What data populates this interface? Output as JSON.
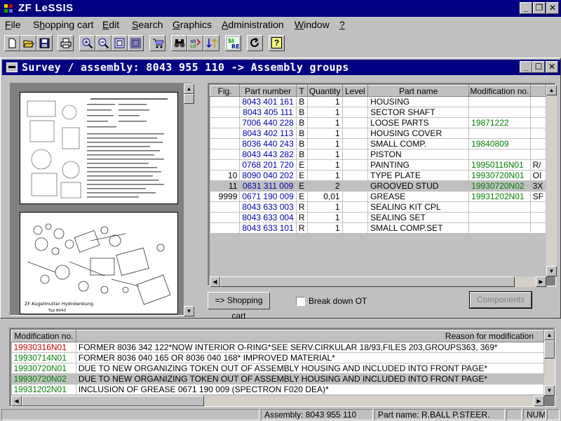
{
  "app": {
    "title": "ZF LeSSIS"
  },
  "menu": [
    {
      "label": "File",
      "u": "F",
      "rest": "ile"
    },
    {
      "label": "Shopping cart",
      "pre": "S",
      "u": "h",
      "rest": "opping cart"
    },
    {
      "label": "Edit",
      "u": "E",
      "rest": "dit"
    },
    {
      "label": "Search",
      "u": "S",
      "rest": "earch"
    },
    {
      "label": "Graphics",
      "u": "G",
      "rest": "raphics"
    },
    {
      "label": "Administration",
      "u": "A",
      "rest": "dministration"
    },
    {
      "label": "Window",
      "u": "W",
      "rest": "indow"
    },
    {
      "label": "?",
      "u": "?",
      "rest": ""
    }
  ],
  "toolbar": {
    "buttons": [
      "new-icon",
      "open-icon",
      "save-icon",
      "print-icon",
      "zoom-in-icon",
      "zoom-out-icon",
      "zoom-fit-icon",
      "zoom-page-icon",
      "shopping-cart-icon",
      "binoculars-icon",
      "search-abc-icon",
      "sort-arrows-icon",
      "si-re-icon",
      "refresh-icon",
      "help-icon"
    ],
    "si_label": "SI",
    "re_label": "RE",
    "help_label": "?"
  },
  "child_window": {
    "title": "Survey / assembly: 8043 955 110 -> Assembly groups"
  },
  "parts_table": {
    "columns": [
      "Fig.",
      "Part number",
      "T",
      "Quantity",
      "Level",
      "Part name",
      "Modification no.",
      ""
    ],
    "rows": [
      {
        "fig": "",
        "part_number": "8043 401 161",
        "t": "B",
        "quantity": "1",
        "level": "",
        "part_name": "HOUSING",
        "mod": "",
        "extra": ""
      },
      {
        "fig": "",
        "part_number": "8043 405 111",
        "t": "B",
        "quantity": "1",
        "level": "",
        "part_name": "SECTOR SHAFT",
        "mod": "",
        "extra": ""
      },
      {
        "fig": "",
        "part_number": "7006 440 228",
        "t": "B",
        "quantity": "1",
        "level": "",
        "part_name": "LOOSE PARTS",
        "mod": "19871222",
        "extra": ""
      },
      {
        "fig": "",
        "part_number": "8043 402 113",
        "t": "B",
        "quantity": "1",
        "level": "",
        "part_name": "HOUSING COVER",
        "mod": "",
        "extra": ""
      },
      {
        "fig": "",
        "part_number": "8036 440 243",
        "t": "B",
        "quantity": "1",
        "level": "",
        "part_name": "SMALL COMP.",
        "mod": "19840809",
        "extra": ""
      },
      {
        "fig": "",
        "part_number": "8043 443 282",
        "t": "B",
        "quantity": "1",
        "level": "",
        "part_name": "PISTON",
        "mod": "",
        "extra": ""
      },
      {
        "fig": "",
        "part_number": "0768 201 720",
        "t": "E",
        "quantity": "1",
        "level": "",
        "part_name": "PAINTING",
        "mod": "19950116N01",
        "extra": "R/"
      },
      {
        "fig": "10",
        "part_number": "8090 040 202",
        "t": "E",
        "quantity": "1",
        "level": "",
        "part_name": "TYPE PLATE",
        "mod": "19930720N01",
        "extra": "OI"
      },
      {
        "fig": "11",
        "part_number": "0631 311 009",
        "t": "E",
        "quantity": "2",
        "level": "",
        "part_name": "GROOVED STUD",
        "mod": "19930720N02",
        "extra": "3X",
        "selected": true
      },
      {
        "fig": "9999",
        "part_number": "0671 190 009",
        "t": "E",
        "quantity": "0,01",
        "level": "",
        "part_name": "GREASE",
        "mod": "19931202N01",
        "extra": "SF"
      },
      {
        "fig": "",
        "part_number": "8043 633 003",
        "t": "R",
        "quantity": "1",
        "level": "",
        "part_name": "SEALING KIT CPL",
        "mod": "",
        "extra": ""
      },
      {
        "fig": "",
        "part_number": "8043 633 004",
        "t": "R",
        "quantity": "1",
        "level": "",
        "part_name": "SEALING SET",
        "mod": "",
        "extra": ""
      },
      {
        "fig": "",
        "part_number": "8043 633 101",
        "t": "R",
        "quantity": "1",
        "level": "",
        "part_name": "SMALL COMP.SET",
        "mod": "",
        "extra": ""
      }
    ]
  },
  "buttons": {
    "shopping_cart": "=> Shopping cart",
    "break_down": "Break down OT",
    "components": "Components"
  },
  "modifications": {
    "columns": [
      "Modification no.",
      "Reason for modification"
    ],
    "rows": [
      {
        "no": "19930316N01",
        "color": "red",
        "reason": "FORMER 8036 342 122*NOW INTERIOR O-RING*SEE  SERV.CIRKULAR 18/93,FILES 203,GROUPS363, 369*"
      },
      {
        "no": "19930714N01",
        "color": "green",
        "reason": "FORMER 8036 040 165 OR 8036 040 168* IMPROVED MATERIAL*"
      },
      {
        "no": "19930720N01",
        "color": "green",
        "reason": "DUE TO NEW ORGANIZING TOKEN OUT OF ASSEMBLY HOUSING AND INCLUDED INTO FRONT PAGE*"
      },
      {
        "no": "19930720N02",
        "color": "green",
        "reason": "DUE TO NEW ORGANIZING TOKEN OUT OF ASSEMBLY HOUSING AND INCLUDED INTO FRONT PAGE*",
        "selected": true
      },
      {
        "no": "19931202N01",
        "color": "green",
        "reason": "INCLUSION OF GREASE 0671 190 009 (SPECTRON F020 DEA)*"
      }
    ]
  },
  "drawing": {
    "caption": "ZF-Kugelmutter Hydrolenkung",
    "caption2": "Typ 8043"
  },
  "status": {
    "assembly": "Assembly: 8043 955 110",
    "part_name": "Part name: R.BALL P.STEER.",
    "num": "NUM"
  },
  "colors": {
    "title_bar": "#000080",
    "part_number": "#0000a8",
    "mod_green": "#008000",
    "mod_red": "#c00000"
  }
}
